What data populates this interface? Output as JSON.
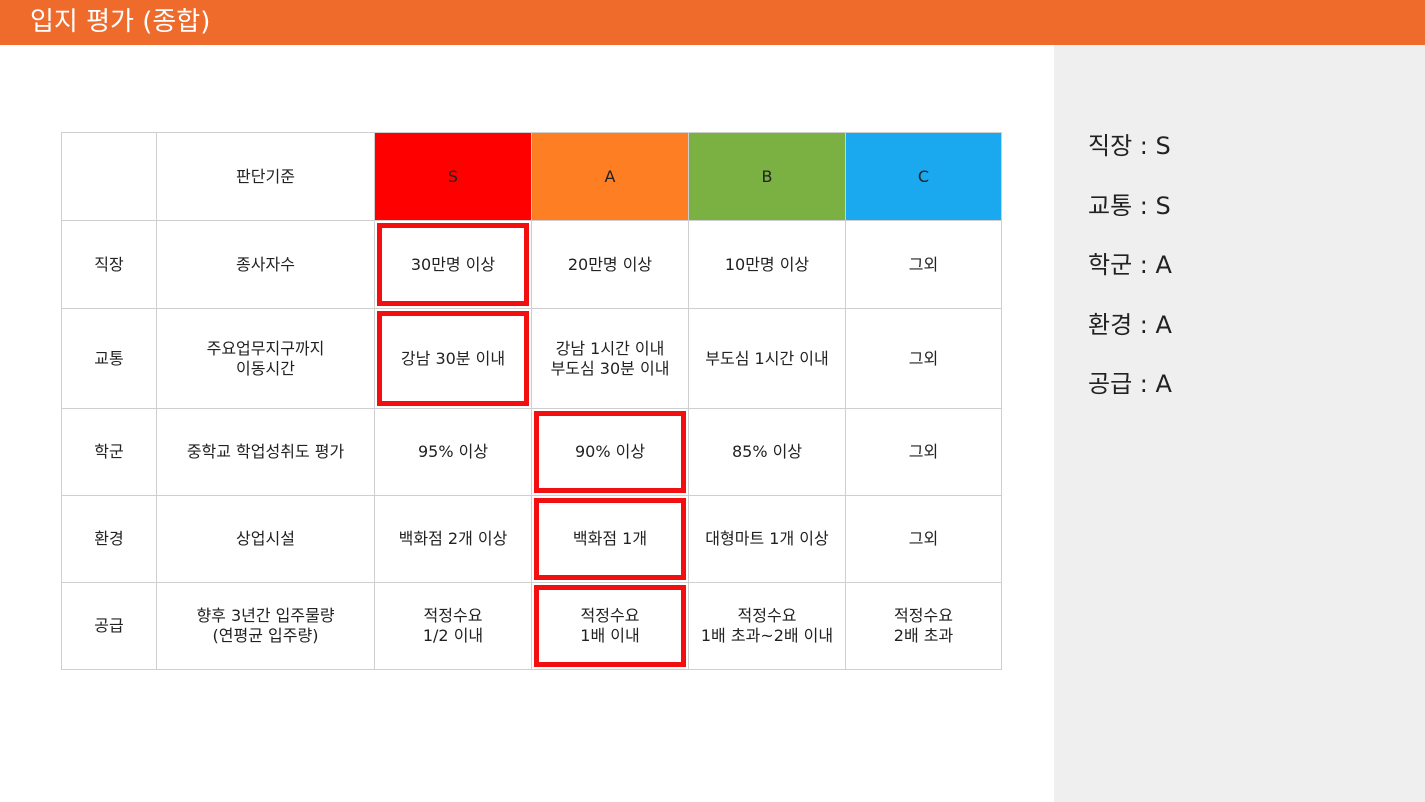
{
  "header": {
    "title": "입지 평가 (종합)",
    "bg_color": "#ee6b2c"
  },
  "table": {
    "criteria_header": "판단기준",
    "grades": [
      {
        "label": "S",
        "color": "#fe0000"
      },
      {
        "label": "A",
        "color": "#fe7e23"
      },
      {
        "label": "B",
        "color": "#7bb043"
      },
      {
        "label": "C",
        "color": "#1aa8ef"
      }
    ],
    "highlight_color": "#f20f0f",
    "rows": [
      {
        "category": "직장",
        "criteria": "종사자수",
        "cells": [
          "30만명 이상",
          "20만명 이상",
          "10만명 이상",
          "그외"
        ],
        "selected_grade": "S"
      },
      {
        "category": "교통",
        "criteria": "주요업무지구까지\n이동시간",
        "cells": [
          "강남 30분 이내",
          "강남 1시간 이내\n부도심 30분 이내",
          "부도심 1시간 이내",
          "그외"
        ],
        "selected_grade": "S"
      },
      {
        "category": "학군",
        "criteria": "중학교 학업성취도 평가",
        "cells": [
          "95% 이상",
          "90% 이상",
          "85% 이상",
          "그외"
        ],
        "selected_grade": "A"
      },
      {
        "category": "환경",
        "criteria": "상업시설",
        "cells": [
          "백화점 2개 이상",
          "백화점 1개",
          "대형마트 1개 이상",
          "그외"
        ],
        "selected_grade": "A"
      },
      {
        "category": "공급",
        "criteria": "향후 3년간 입주물량\n(연평균 입주량)",
        "cells": [
          "적정수요\n1/2 이내",
          "적정수요\n1배 이내",
          "적정수요\n1배 초과~2배 이내",
          "적정수요\n2배 초과"
        ],
        "selected_grade": "A"
      }
    ]
  },
  "summary": [
    "직장 : S",
    "교통 : S",
    "학군 : A",
    "환경 : A",
    "공급 : A"
  ]
}
